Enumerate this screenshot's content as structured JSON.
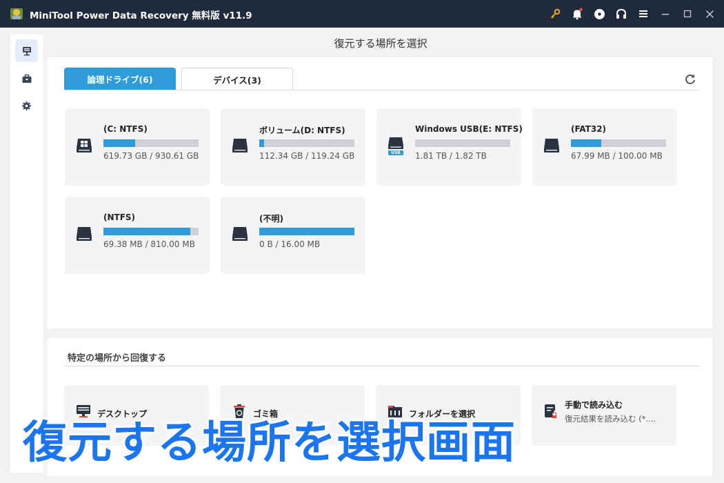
{
  "window": {
    "title": "MiniTool Power Data Recovery 無料版 v11.9",
    "icons": [
      "key-icon",
      "bell-icon",
      "disc-icon",
      "headphones-icon",
      "menu-icon",
      "minimize-icon",
      "maximize-icon",
      "close-icon"
    ],
    "notification_dot_color": "#e8413c"
  },
  "sidebar": {
    "items": [
      {
        "icon": "this-pc-icon",
        "active": true
      },
      {
        "icon": "toolkit-icon",
        "active": false
      },
      {
        "icon": "settings-icon",
        "active": false
      }
    ]
  },
  "main": {
    "page_title": "復元する場所を選択",
    "tabs": [
      {
        "label": "論理ドライブ(6)",
        "active": true
      },
      {
        "label": "デバイス(3)",
        "active": false
      }
    ],
    "drives": [
      {
        "name": "(C: NTFS)",
        "size": "619.73 GB / 930.61 GB",
        "used_fraction": 0.333,
        "icon": "windows-drive-icon"
      },
      {
        "name": "ボリューム(D: NTFS)",
        "size": "112.34 GB / 119.24 GB",
        "used_fraction": 0.05,
        "icon": "drive-icon"
      },
      {
        "name": "Windows USB(E: NTFS)",
        "size": "1.81 TB / 1.82 TB",
        "used_fraction": 0.0,
        "icon": "usb-drive-icon",
        "badge": "USB"
      },
      {
        "name": "(FAT32)",
        "size": "67.99 MB / 100.00 MB",
        "used_fraction": 0.32,
        "icon": "drive-icon"
      },
      {
        "name": "(NTFS)",
        "size": "69.38 MB / 810.00 MB",
        "used_fraction": 0.915,
        "icon": "drive-icon"
      },
      {
        "name": "(不明)",
        "size": "0 B / 16.00 MB",
        "used_fraction": 1.0,
        "icon": "drive-icon"
      }
    ]
  },
  "specific": {
    "title": "特定の場所から回復する",
    "items": [
      {
        "label": "デスクトップ",
        "icon": "desktop-icon"
      },
      {
        "label": "ゴミ箱",
        "icon": "recycle-bin-icon"
      },
      {
        "label": "フォルダーを選択",
        "icon": "folder-icon"
      },
      {
        "label": "手動で読み込む",
        "sub": "復元結果を読み込む (*....",
        "icon": "load-manually-icon"
      }
    ]
  },
  "caption": "復元する場所を選択画面",
  "colors": {
    "accent": "#2f9bd9",
    "titlebar": "#1f2a3c",
    "caption": "#1b74f0"
  }
}
